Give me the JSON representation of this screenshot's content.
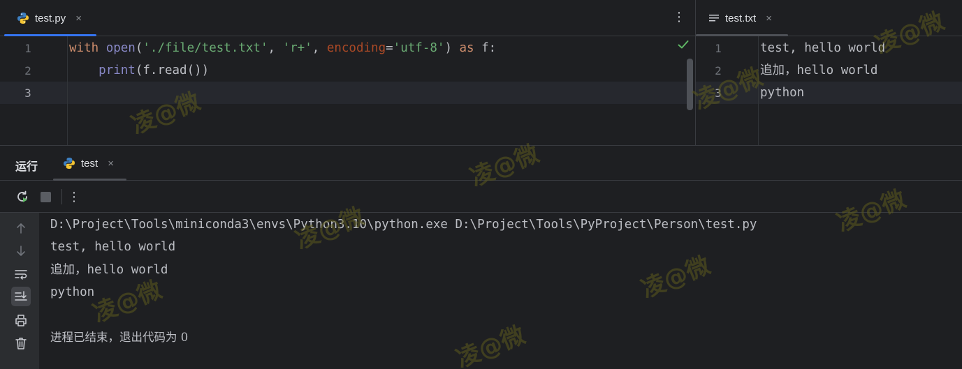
{
  "editor_left": {
    "tab": {
      "label": "test.py",
      "close": "×",
      "icon": "python-icon",
      "accent": "#3574f0"
    },
    "line_numbers": [
      "1",
      "2",
      "3"
    ],
    "lines": [
      {
        "tokens": [
          {
            "text": "with ",
            "cls": "kw"
          },
          {
            "text": "open",
            "cls": "builtin"
          },
          {
            "text": "(",
            "cls": "plain"
          },
          {
            "text": "'./file/test.txt'",
            "cls": "str"
          },
          {
            "text": ", ",
            "cls": "plain"
          },
          {
            "text": "'r+'",
            "cls": "str"
          },
          {
            "text": ", ",
            "cls": "plain"
          },
          {
            "text": "encoding",
            "cls": "param"
          },
          {
            "text": "=",
            "cls": "plain"
          },
          {
            "text": "'utf-8'",
            "cls": "str"
          },
          {
            "text": ") ",
            "cls": "plain"
          },
          {
            "text": "as ",
            "cls": "kw"
          },
          {
            "text": "f:",
            "cls": "plain"
          }
        ]
      },
      {
        "tokens": [
          {
            "text": "    ",
            "cls": "plain"
          },
          {
            "text": "print",
            "cls": "builtin"
          },
          {
            "text": "(f.read())",
            "cls": "plain"
          }
        ]
      },
      {
        "tokens": []
      }
    ],
    "status_icon": "check-icon",
    "menu_icon": "kebab-menu-icon"
  },
  "editor_right": {
    "tab": {
      "label": "test.txt",
      "close": "×",
      "icon": "text-file-icon"
    },
    "line_numbers": [
      "1",
      "2",
      "3"
    ],
    "lines": [
      "test, hello world",
      "追加，hello world",
      "python"
    ]
  },
  "run": {
    "title": "运行",
    "tab_label": "test",
    "tab_close": "×",
    "toolbar_icons": [
      "rerun-icon",
      "stop-icon",
      "more-icon"
    ],
    "side_icons": [
      "arrow-up-icon",
      "arrow-down-icon",
      "soft-wrap-icon",
      "scroll-to-end-icon",
      "print-icon",
      "trash-icon"
    ],
    "console": [
      "D:\\Project\\Tools\\miniconda3\\envs\\Python3.10\\python.exe D:\\Project\\Tools\\PyProject\\Person\\test.py",
      "test, hello world",
      "追加，hello world",
      "python",
      "",
      "进程已结束，退出代码为 0"
    ]
  },
  "watermark": "凌@微",
  "colors": {
    "background": "#1e1f22",
    "accent": "#3574f0",
    "success": "#5fb865"
  }
}
